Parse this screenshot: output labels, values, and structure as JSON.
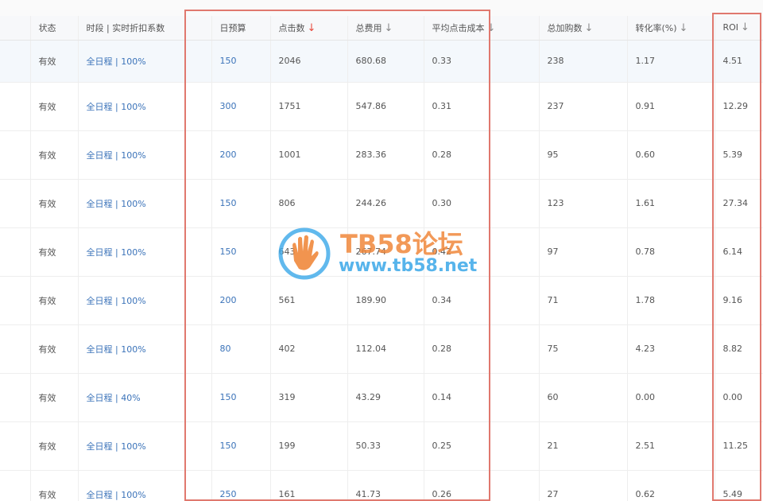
{
  "table": {
    "headers": {
      "status": "状态",
      "period": "时段 | 实时折扣系数",
      "budget": "日预算",
      "clicks": "点击数",
      "cost": "总费用",
      "cpc": "平均点击成本",
      "cart": "总加购数",
      "cvr": "转化率(%)",
      "roi": "ROI"
    },
    "sort_arrow": "↓",
    "rows": [
      {
        "status": "有效",
        "period": "全日程",
        "discount": "100%",
        "budget": "150",
        "clicks": "2046",
        "cost": "680.68",
        "cpc": "0.33",
        "cart": "238",
        "cvr": "1.17",
        "roi": "4.51"
      },
      {
        "status": "有效",
        "period": "全日程",
        "discount": "100%",
        "budget": "300",
        "clicks": "1751",
        "cost": "547.86",
        "cpc": "0.31",
        "cart": "237",
        "cvr": "0.91",
        "roi": "12.29"
      },
      {
        "status": "有效",
        "period": "全日程",
        "discount": "100%",
        "budget": "200",
        "clicks": "1001",
        "cost": "283.36",
        "cpc": "0.28",
        "cart": "95",
        "cvr": "0.60",
        "roi": "5.39"
      },
      {
        "status": "有效",
        "period": "全日程",
        "discount": "100%",
        "budget": "150",
        "clicks": "806",
        "cost": "244.26",
        "cpc": "0.30",
        "cart": "123",
        "cvr": "1.61",
        "roi": "27.34"
      },
      {
        "status": "有效",
        "period": "全日程",
        "discount": "100%",
        "budget": "150",
        "clicks": "643",
        "cost": "267.74",
        "cpc": "0.42",
        "cart": "97",
        "cvr": "0.78",
        "roi": "6.14"
      },
      {
        "status": "有效",
        "period": "全日程",
        "discount": "100%",
        "budget": "200",
        "clicks": "561",
        "cost": "189.90",
        "cpc": "0.34",
        "cart": "71",
        "cvr": "1.78",
        "roi": "9.16"
      },
      {
        "status": "有效",
        "period": "全日程",
        "discount": "100%",
        "budget": "80",
        "clicks": "402",
        "cost": "112.04",
        "cpc": "0.28",
        "cart": "75",
        "cvr": "4.23",
        "roi": "8.82"
      },
      {
        "status": "有效",
        "period": "全日程",
        "discount": "40%",
        "budget": "150",
        "clicks": "319",
        "cost": "43.29",
        "cpc": "0.14",
        "cart": "60",
        "cvr": "0.00",
        "roi": "0.00"
      },
      {
        "status": "有效",
        "period": "全日程",
        "discount": "100%",
        "budget": "150",
        "clicks": "199",
        "cost": "50.33",
        "cpc": "0.25",
        "cart": "21",
        "cvr": "2.51",
        "roi": "11.25"
      },
      {
        "status": "有效",
        "period": "全日程",
        "discount": "100%",
        "budget": "250",
        "clicks": "161",
        "cost": "41.73",
        "cpc": "0.26",
        "cart": "27",
        "cvr": "0.62",
        "roi": "5.49"
      }
    ]
  },
  "watermark": {
    "title": "TB58论坛",
    "url": "www.tb58.net"
  },
  "colors": {
    "link": "#3b73b9",
    "sort_active": "#e8483b",
    "highlight_box": "#e0786e",
    "watermark_orange": "#f0883c",
    "watermark_blue": "#3aa7e8"
  }
}
